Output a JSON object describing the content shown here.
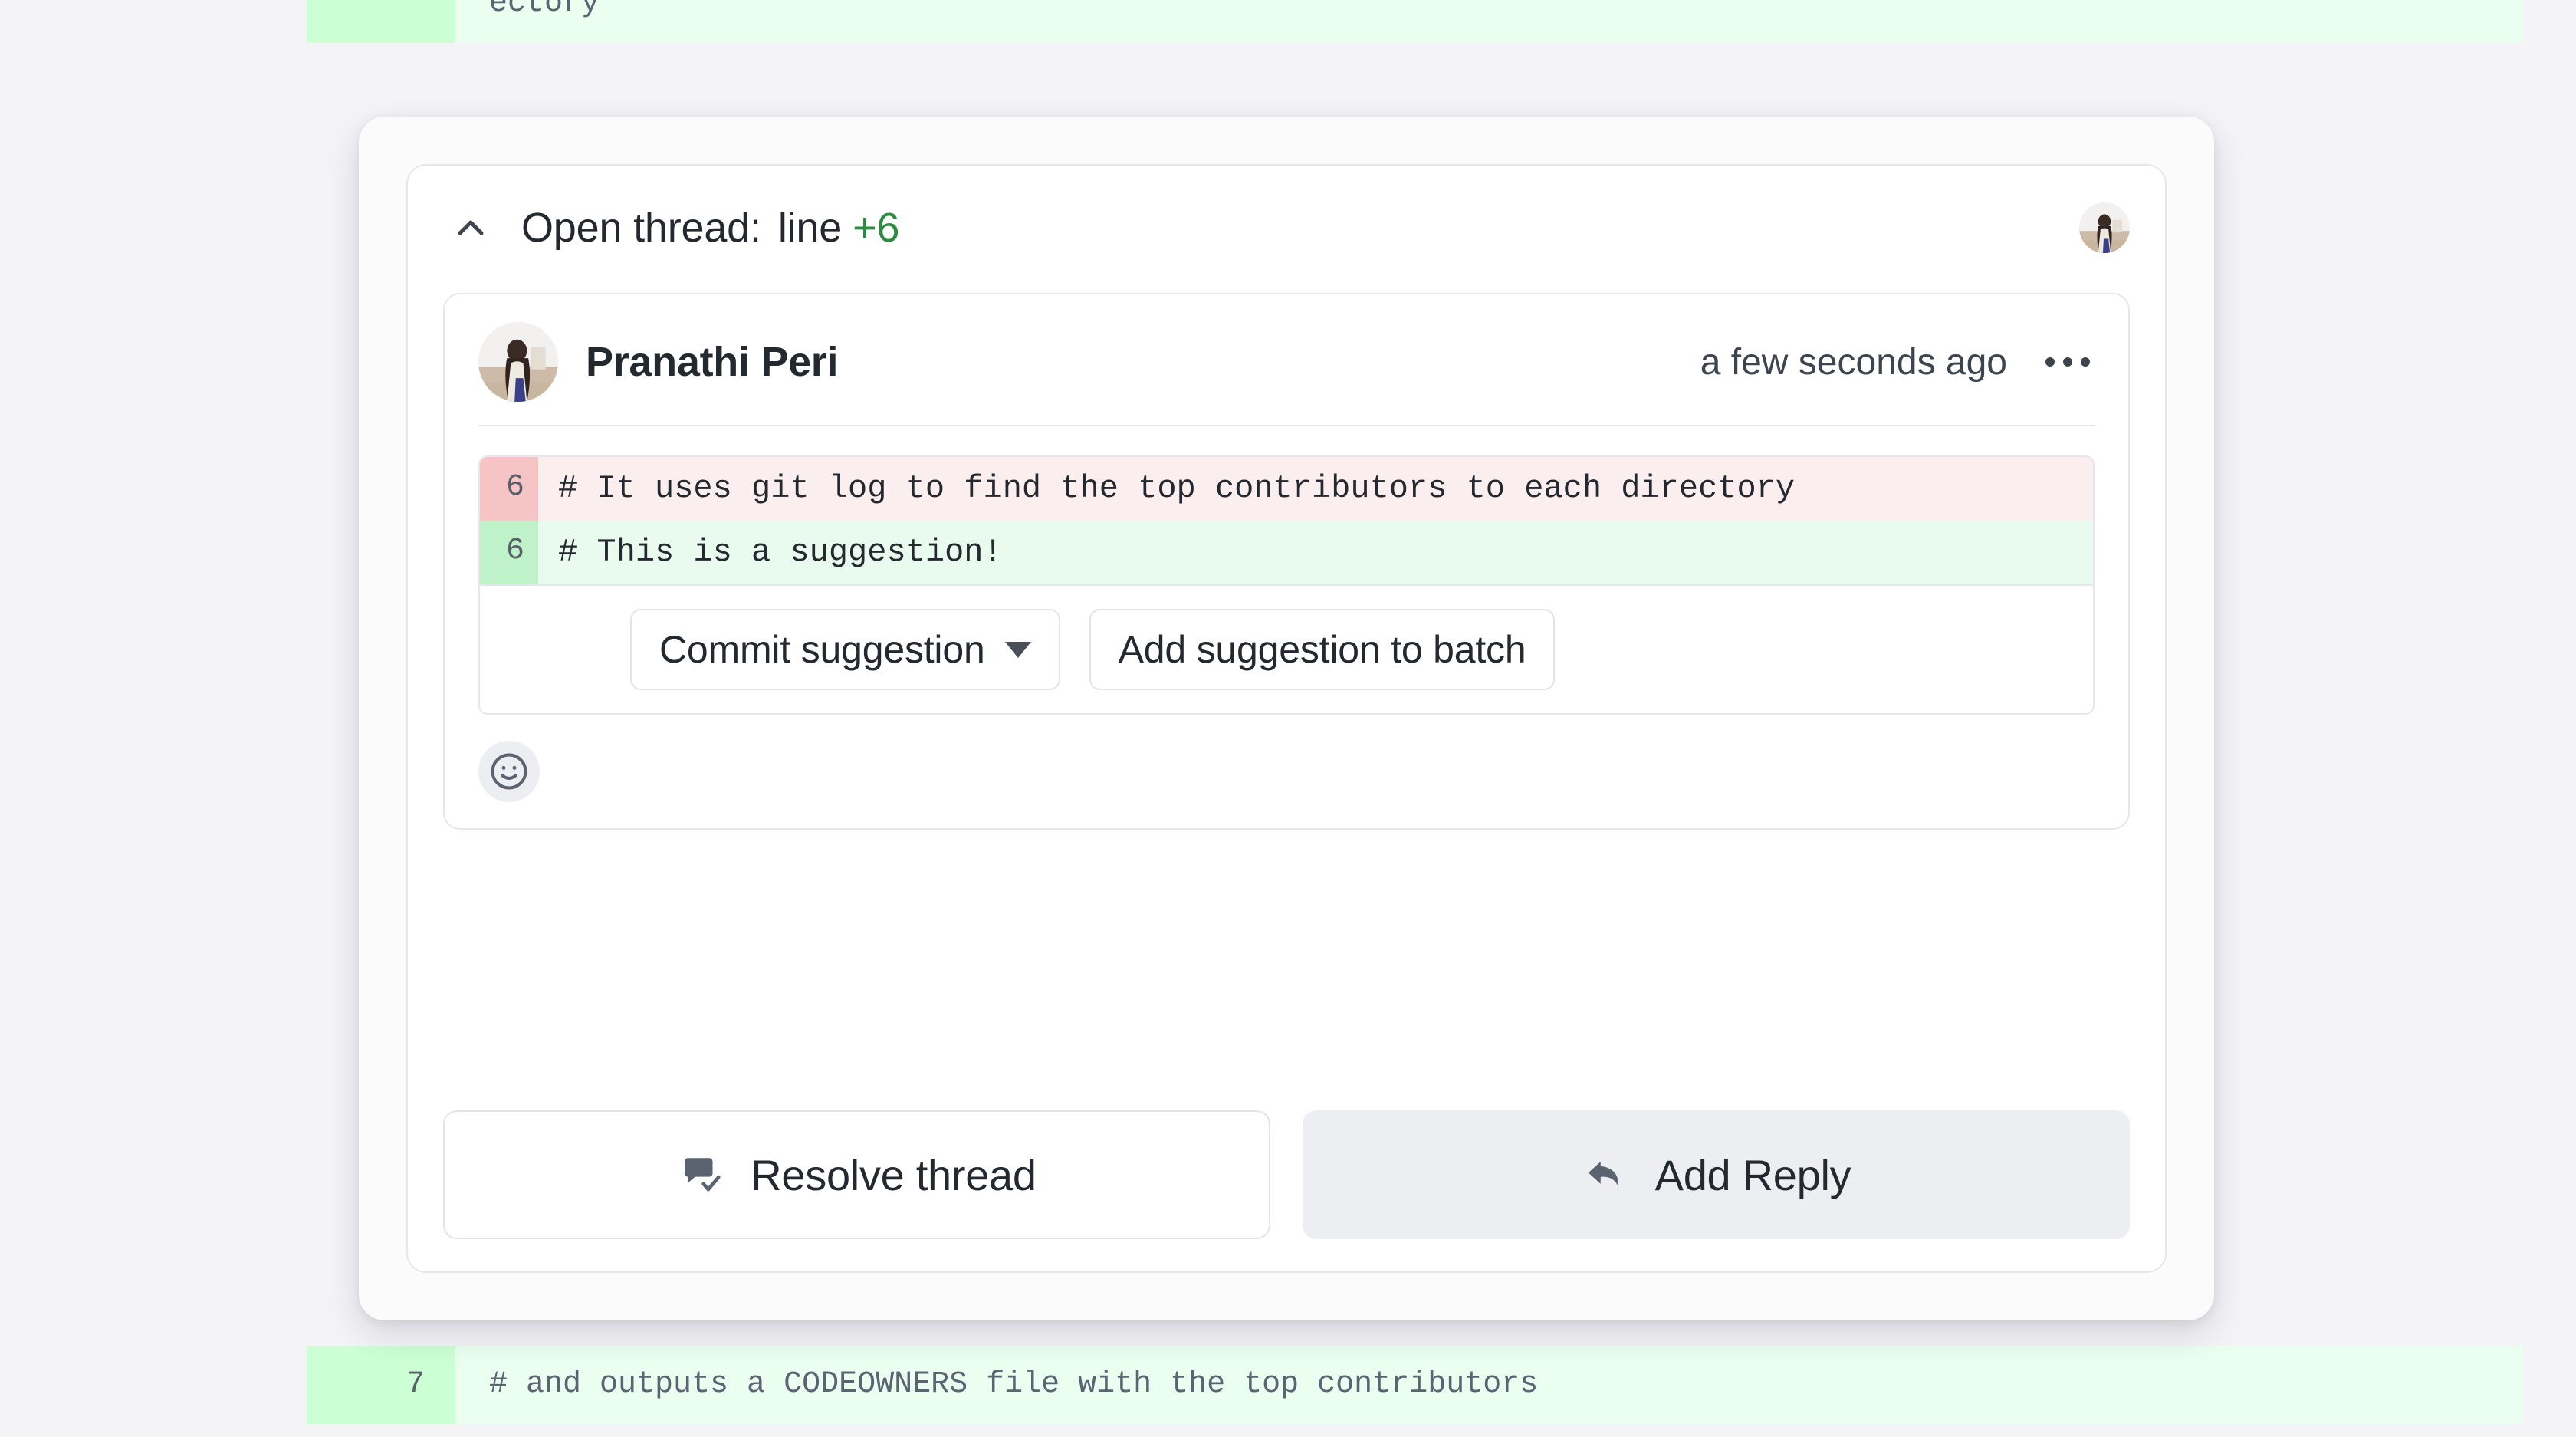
{
  "diff_context": {
    "top_line": {
      "number": "",
      "text": "ectory"
    },
    "bottom_line": {
      "number": "7",
      "text": "# and outputs a CODEOWNERS file with the top contributors"
    }
  },
  "thread": {
    "collapse_icon": "chevron-up-icon",
    "title_label": "Open thread:",
    "line_word": "line",
    "line_badge": "+6",
    "badge_color": "#2c8a43",
    "header_avatar": "user-avatar"
  },
  "comment": {
    "author": "Pranathi Peri",
    "avatar": "user-avatar",
    "timestamp": "a few seconds ago",
    "menu_icon": "kebab-menu-icon",
    "suggestion": {
      "deleted": {
        "number": "6",
        "text": "# It uses git log to find the top contributors to each directory"
      },
      "added": {
        "number": "6",
        "text": "# This is a suggestion!"
      },
      "commit_button": "Commit suggestion",
      "commit_caret": "caret-down-icon",
      "batch_button": "Add suggestion to batch"
    },
    "reaction_icon": "smiley-face-icon"
  },
  "footer": {
    "resolve_label": "Resolve thread",
    "resolve_icon": "comment-check-icon",
    "reply_label": "Add Reply",
    "reply_icon": "reply-arrow-icon"
  }
}
